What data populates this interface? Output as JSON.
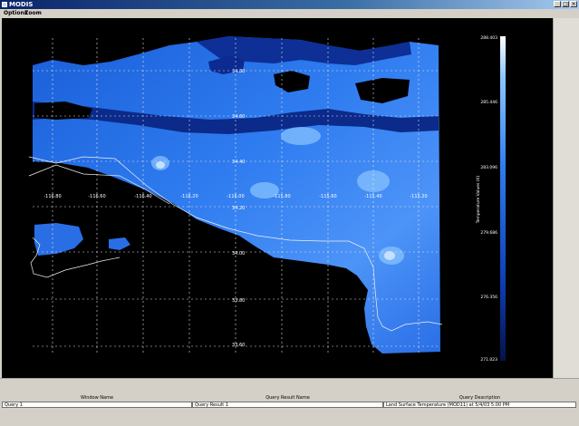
{
  "window": {
    "title": "MODIS",
    "buttons": {
      "minimize": "_",
      "maximize": "□",
      "close": "×"
    }
  },
  "menu": [
    {
      "label": "Options"
    },
    {
      "label": "Zoom"
    }
  ],
  "map": {
    "lat_labels": [
      "34.80",
      "34.60",
      "34.40",
      "34.20",
      "34.00",
      "33.80",
      "33.60"
    ],
    "lon_labels": [
      "-116.80",
      "-116.60",
      "-116.40",
      "-116.20",
      "-116.00",
      "-115.80",
      "-115.60",
      "-115.40",
      "-115.20"
    ],
    "colorbar": {
      "title": "Temperature Values (K)",
      "ticks": [
        "288.403",
        "285.446",
        "283.096",
        "279.686",
        "276.356",
        "271.023"
      ]
    }
  },
  "table": {
    "headers": [
      "Window Name",
      "Query Result Name",
      "Query Description"
    ],
    "row": [
      "Query 1",
      "Query Result 1",
      "Land Surface Temperature (MOD11) at 5/4/03 5:00 PM"
    ]
  },
  "colors": {
    "accent": "#0a246a",
    "dark_blue": "#0c2f9a",
    "mid_blue": "#2a76e6",
    "light_blue": "#7cc0ff"
  }
}
